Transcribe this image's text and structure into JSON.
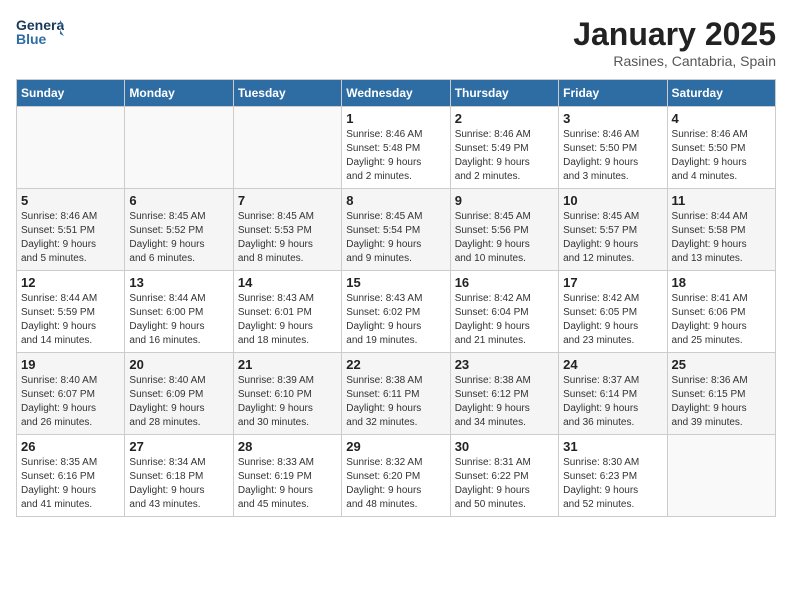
{
  "header": {
    "logo_line1": "General",
    "logo_line2": "Blue",
    "month_title": "January 2025",
    "location": "Rasines, Cantabria, Spain"
  },
  "days_of_week": [
    "Sunday",
    "Monday",
    "Tuesday",
    "Wednesday",
    "Thursday",
    "Friday",
    "Saturday"
  ],
  "weeks": [
    [
      {
        "day": "",
        "info": ""
      },
      {
        "day": "",
        "info": ""
      },
      {
        "day": "",
        "info": ""
      },
      {
        "day": "1",
        "info": "Sunrise: 8:46 AM\nSunset: 5:48 PM\nDaylight: 9 hours\nand 2 minutes."
      },
      {
        "day": "2",
        "info": "Sunrise: 8:46 AM\nSunset: 5:49 PM\nDaylight: 9 hours\nand 2 minutes."
      },
      {
        "day": "3",
        "info": "Sunrise: 8:46 AM\nSunset: 5:50 PM\nDaylight: 9 hours\nand 3 minutes."
      },
      {
        "day": "4",
        "info": "Sunrise: 8:46 AM\nSunset: 5:50 PM\nDaylight: 9 hours\nand 4 minutes."
      }
    ],
    [
      {
        "day": "5",
        "info": "Sunrise: 8:46 AM\nSunset: 5:51 PM\nDaylight: 9 hours\nand 5 minutes."
      },
      {
        "day": "6",
        "info": "Sunrise: 8:45 AM\nSunset: 5:52 PM\nDaylight: 9 hours\nand 6 minutes."
      },
      {
        "day": "7",
        "info": "Sunrise: 8:45 AM\nSunset: 5:53 PM\nDaylight: 9 hours\nand 8 minutes."
      },
      {
        "day": "8",
        "info": "Sunrise: 8:45 AM\nSunset: 5:54 PM\nDaylight: 9 hours\nand 9 minutes."
      },
      {
        "day": "9",
        "info": "Sunrise: 8:45 AM\nSunset: 5:56 PM\nDaylight: 9 hours\nand 10 minutes."
      },
      {
        "day": "10",
        "info": "Sunrise: 8:45 AM\nSunset: 5:57 PM\nDaylight: 9 hours\nand 12 minutes."
      },
      {
        "day": "11",
        "info": "Sunrise: 8:44 AM\nSunset: 5:58 PM\nDaylight: 9 hours\nand 13 minutes."
      }
    ],
    [
      {
        "day": "12",
        "info": "Sunrise: 8:44 AM\nSunset: 5:59 PM\nDaylight: 9 hours\nand 14 minutes."
      },
      {
        "day": "13",
        "info": "Sunrise: 8:44 AM\nSunset: 6:00 PM\nDaylight: 9 hours\nand 16 minutes."
      },
      {
        "day": "14",
        "info": "Sunrise: 8:43 AM\nSunset: 6:01 PM\nDaylight: 9 hours\nand 18 minutes."
      },
      {
        "day": "15",
        "info": "Sunrise: 8:43 AM\nSunset: 6:02 PM\nDaylight: 9 hours\nand 19 minutes."
      },
      {
        "day": "16",
        "info": "Sunrise: 8:42 AM\nSunset: 6:04 PM\nDaylight: 9 hours\nand 21 minutes."
      },
      {
        "day": "17",
        "info": "Sunrise: 8:42 AM\nSunset: 6:05 PM\nDaylight: 9 hours\nand 23 minutes."
      },
      {
        "day": "18",
        "info": "Sunrise: 8:41 AM\nSunset: 6:06 PM\nDaylight: 9 hours\nand 25 minutes."
      }
    ],
    [
      {
        "day": "19",
        "info": "Sunrise: 8:40 AM\nSunset: 6:07 PM\nDaylight: 9 hours\nand 26 minutes."
      },
      {
        "day": "20",
        "info": "Sunrise: 8:40 AM\nSunset: 6:09 PM\nDaylight: 9 hours\nand 28 minutes."
      },
      {
        "day": "21",
        "info": "Sunrise: 8:39 AM\nSunset: 6:10 PM\nDaylight: 9 hours\nand 30 minutes."
      },
      {
        "day": "22",
        "info": "Sunrise: 8:38 AM\nSunset: 6:11 PM\nDaylight: 9 hours\nand 32 minutes."
      },
      {
        "day": "23",
        "info": "Sunrise: 8:38 AM\nSunset: 6:12 PM\nDaylight: 9 hours\nand 34 minutes."
      },
      {
        "day": "24",
        "info": "Sunrise: 8:37 AM\nSunset: 6:14 PM\nDaylight: 9 hours\nand 36 minutes."
      },
      {
        "day": "25",
        "info": "Sunrise: 8:36 AM\nSunset: 6:15 PM\nDaylight: 9 hours\nand 39 minutes."
      }
    ],
    [
      {
        "day": "26",
        "info": "Sunrise: 8:35 AM\nSunset: 6:16 PM\nDaylight: 9 hours\nand 41 minutes."
      },
      {
        "day": "27",
        "info": "Sunrise: 8:34 AM\nSunset: 6:18 PM\nDaylight: 9 hours\nand 43 minutes."
      },
      {
        "day": "28",
        "info": "Sunrise: 8:33 AM\nSunset: 6:19 PM\nDaylight: 9 hours\nand 45 minutes."
      },
      {
        "day": "29",
        "info": "Sunrise: 8:32 AM\nSunset: 6:20 PM\nDaylight: 9 hours\nand 48 minutes."
      },
      {
        "day": "30",
        "info": "Sunrise: 8:31 AM\nSunset: 6:22 PM\nDaylight: 9 hours\nand 50 minutes."
      },
      {
        "day": "31",
        "info": "Sunrise: 8:30 AM\nSunset: 6:23 PM\nDaylight: 9 hours\nand 52 minutes."
      },
      {
        "day": "",
        "info": ""
      }
    ]
  ]
}
